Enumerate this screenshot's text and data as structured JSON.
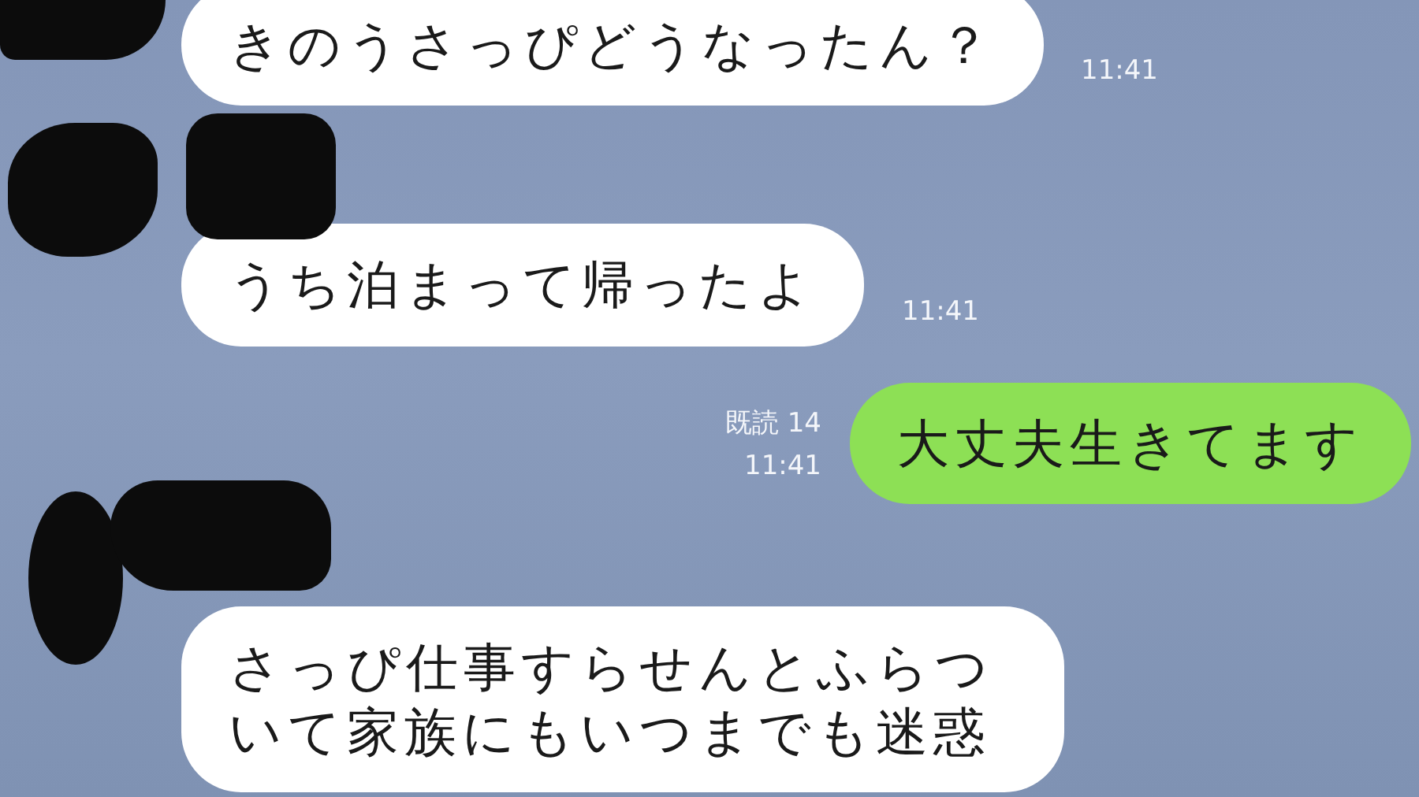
{
  "messages": [
    {
      "kind": "incoming",
      "text": "きのうさっぴどうなったん？",
      "time": "11:41"
    },
    {
      "kind": "incoming",
      "text": "うち泊まって帰ったよ",
      "time": "11:41"
    },
    {
      "kind": "outgoing",
      "read": "既読 14",
      "text": "大丈夫生きてます",
      "time": "11:41"
    },
    {
      "kind": "incoming",
      "text": "さっぴ仕事すらせんとふらついて家族にもいつまでも迷惑"
    }
  ]
}
